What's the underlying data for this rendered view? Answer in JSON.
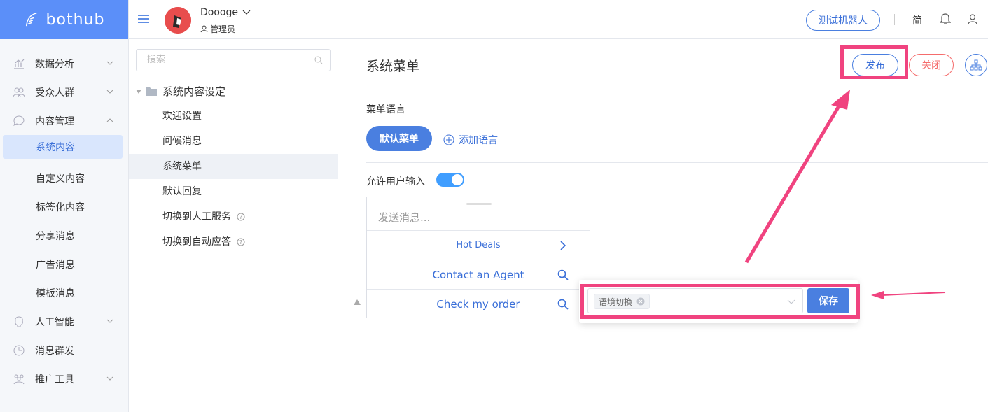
{
  "brand": {
    "name": "bothub"
  },
  "header": {
    "username": "Doooge",
    "role": "管理员",
    "test_robot_label": "测试机器人",
    "lang_label": "简"
  },
  "sidebar": {
    "items": [
      {
        "label": "数据分析",
        "icon": "chart-icon"
      },
      {
        "label": "受众人群",
        "icon": "users-icon"
      },
      {
        "label": "内容管理",
        "icon": "chat-icon"
      },
      {
        "label": "人工智能",
        "icon": "brain-icon"
      },
      {
        "label": "消息群发",
        "icon": "broadcast-icon"
      },
      {
        "label": "推广工具",
        "icon": "promo-icon"
      }
    ],
    "sub_items": [
      "系统内容",
      "自定义内容",
      "标签化内容",
      "分享消息",
      "广告消息",
      "模板消息"
    ]
  },
  "middle": {
    "search_placeholder": "搜索",
    "tree_root": "系统内容设定",
    "tree_items": [
      "欢迎设置",
      "问候消息",
      "系统菜单",
      "默认回复",
      "切换到人工服务",
      "切换到自动应答"
    ]
  },
  "main": {
    "title": "系统菜单",
    "publish_label": "发布",
    "close_label": "关闭",
    "menu_lang_label": "菜单语言",
    "default_menu_label": "默认菜单",
    "add_lang_label": "添加语言",
    "allow_input_label": "允许用户输入",
    "allow_input_on": true,
    "message_placeholder": "发送消息...",
    "menu_rows": [
      {
        "label": "Hot Deals",
        "icon": "chevron-right-icon"
      },
      {
        "label": "Contact an Agent",
        "icon": "search-icon"
      },
      {
        "label": "Check my order",
        "icon": "search-icon"
      }
    ],
    "popup": {
      "tag_label": "语境切换",
      "save_label": "保存"
    }
  },
  "colors": {
    "brand": "#5b8ff9",
    "primary": "#4a7fe0",
    "danger": "#f56c6c",
    "highlight": "#f0437f",
    "active_bg": "#d9e6fd"
  }
}
